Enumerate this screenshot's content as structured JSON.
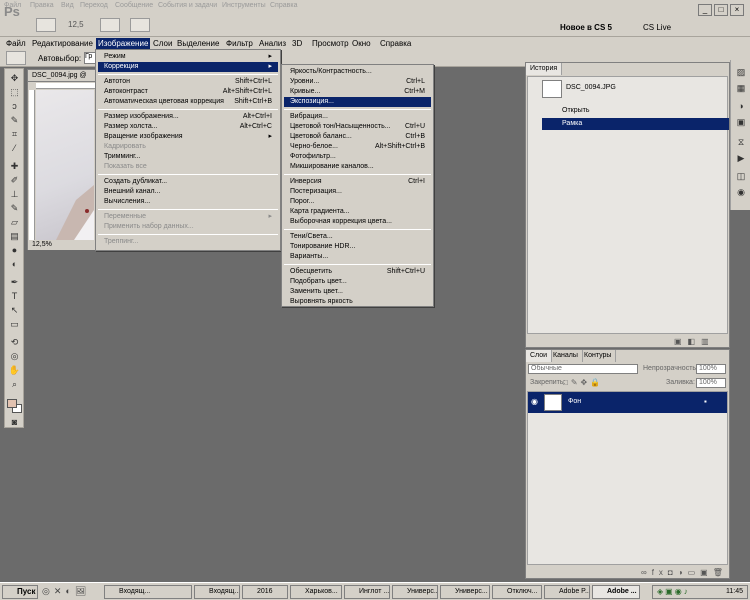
{
  "appbar": {
    "logo": "Ps",
    "top_menu": [
      "Файл",
      "Правка",
      "Вид",
      "Переход",
      "Сообщение",
      "События и задачи",
      "Инструменты",
      "Справка"
    ],
    "zoom": "12,5",
    "workspace": "Новое в CS 5",
    "cs_live": "CS Live"
  },
  "menubar": [
    "Файл",
    "Редактирование",
    "Изображение",
    "Слои",
    "Выделение",
    "Фильтр",
    "Анализ",
    "3D",
    "Просмотр",
    "Окно",
    "Справка"
  ],
  "optbar": {
    "autoselect": "Автовыбор:",
    "group": "Гр"
  },
  "document": {
    "tab": "DSC_0094.jpg @",
    "zoom": "12,5%"
  },
  "image_menu": [
    {
      "label": "Режим",
      "sub": true
    },
    {
      "label": "Коррекция",
      "sub": true,
      "hl": true
    },
    {
      "sep": true
    },
    {
      "label": "Автотон",
      "sc": "Shift+Ctrl+L"
    },
    {
      "label": "Автоконтраст",
      "sc": "Alt+Shift+Ctrl+L"
    },
    {
      "label": "Автоматическая цветовая коррекция",
      "sc": "Shift+Ctrl+B"
    },
    {
      "sep": true
    },
    {
      "label": "Размер изображения...",
      "sc": "Alt+Ctrl+I"
    },
    {
      "label": "Размер холста...",
      "sc": "Alt+Ctrl+C"
    },
    {
      "label": "Вращение изображения",
      "sub": true
    },
    {
      "label": "Кадрировать",
      "dis": true
    },
    {
      "label": "Тримминг..."
    },
    {
      "label": "Показать все",
      "dis": true
    },
    {
      "sep": true
    },
    {
      "label": "Создать дубликат..."
    },
    {
      "label": "Внешний канал..."
    },
    {
      "label": "Вычисления..."
    },
    {
      "sep": true
    },
    {
      "label": "Переменные",
      "sub": true,
      "dis": true
    },
    {
      "label": "Применить набор данных...",
      "dis": true
    },
    {
      "sep": true
    },
    {
      "label": "Треппинг...",
      "dis": true
    }
  ],
  "adjust_menu": [
    {
      "label": "Яркость/Контрастность..."
    },
    {
      "label": "Уровни...",
      "sc": "Ctrl+L"
    },
    {
      "label": "Кривые...",
      "sc": "Ctrl+M"
    },
    {
      "label": "Экспозиция...",
      "hl": true
    },
    {
      "sep": true
    },
    {
      "label": "Вибрация..."
    },
    {
      "label": "Цветовой тон/Насыщенность...",
      "sc": "Ctrl+U"
    },
    {
      "label": "Цветовой баланс...",
      "sc": "Ctrl+B"
    },
    {
      "label": "Черно-белое...",
      "sc": "Alt+Shift+Ctrl+B"
    },
    {
      "label": "Фотофильтр..."
    },
    {
      "label": "Микширование каналов..."
    },
    {
      "sep": true
    },
    {
      "label": "Инверсия",
      "sc": "Ctrl+I"
    },
    {
      "label": "Постеризация..."
    },
    {
      "label": "Порог..."
    },
    {
      "label": "Карта градиента..."
    },
    {
      "label": "Выборочная коррекция цвета..."
    },
    {
      "sep": true
    },
    {
      "label": "Тени/Света..."
    },
    {
      "label": "Тонирование HDR..."
    },
    {
      "label": "Варианты..."
    },
    {
      "sep": true
    },
    {
      "label": "Обесцветить",
      "sc": "Shift+Ctrl+U"
    },
    {
      "label": "Подобрать цвет..."
    },
    {
      "label": "Заменить цвет..."
    },
    {
      "label": "Выровнять яркость"
    }
  ],
  "history": {
    "tab": "История",
    "snapshot": "DSC_0094.JPG",
    "items": [
      "Открыть",
      "Рамка"
    ]
  },
  "layers": {
    "tabs": [
      "Слои",
      "Каналы",
      "Контуры"
    ],
    "blend": "Обычные",
    "opacity_label": "Непрозрачность:",
    "opacity": "100%",
    "lock_label": "Закрепить:",
    "fill_label": "Заливка:",
    "fill": "100%",
    "layer_name": "Фон"
  },
  "taskbar": {
    "start": "Пуск",
    "tasks": [
      "Входящ...",
      "Входящ...",
      "2016",
      "Харьков...",
      "Инглот ...",
      "Универс...",
      "Универс...",
      "Отключ...",
      "Adobe P...",
      "Adobe ..."
    ],
    "time": "11:45"
  }
}
